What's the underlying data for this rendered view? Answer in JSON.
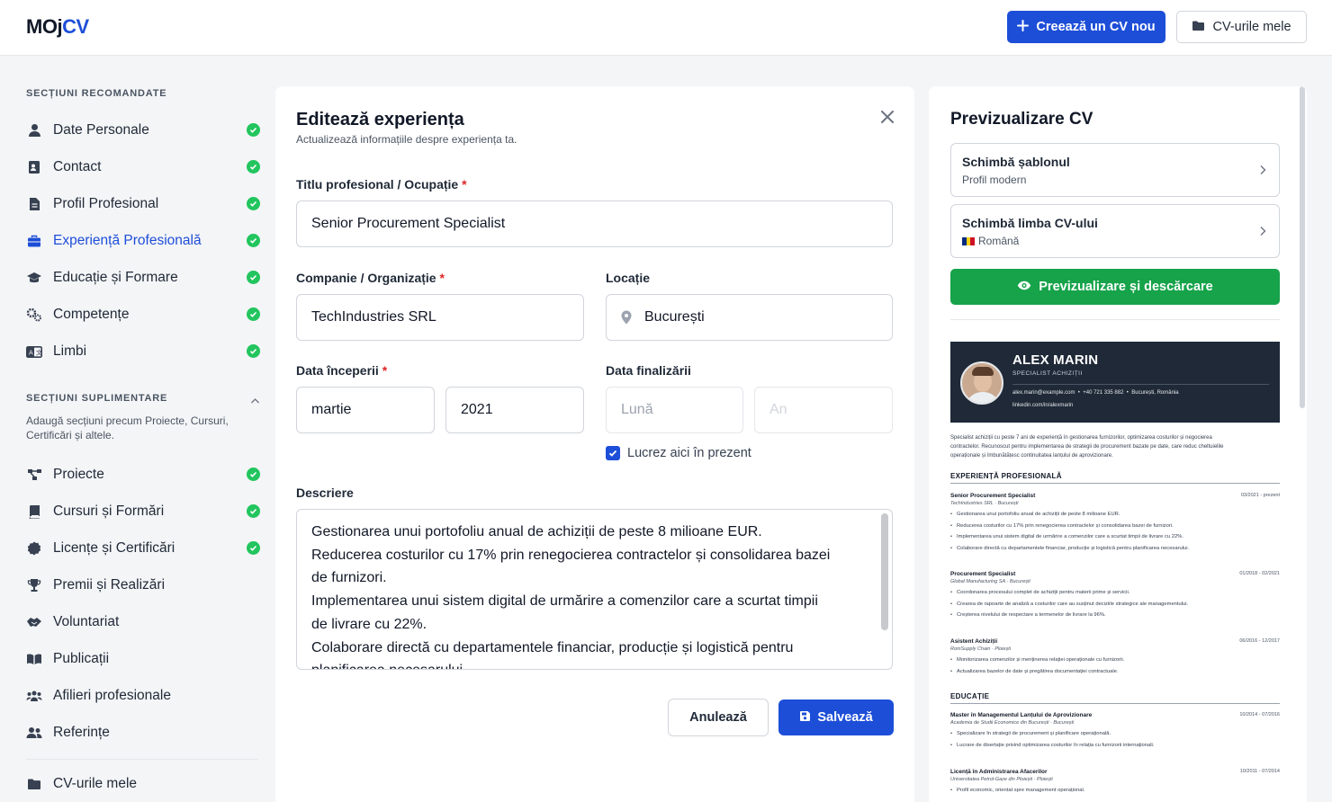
{
  "header": {
    "logo_main": "MOjCV",
    "logo_prefix": "MOj",
    "logo_accent": "CV",
    "new_cv_label": "Creează un CV nou",
    "my_cvs_label": "CV-urile mele"
  },
  "sidebar": {
    "recommended_title": "SECȚIUNI RECOMANDATE",
    "recommended": [
      {
        "label": "Date Personale",
        "icon": "user-icon",
        "done": true
      },
      {
        "label": "Contact",
        "icon": "contact-card-icon",
        "done": true
      },
      {
        "label": "Profil Profesional",
        "icon": "file-icon",
        "done": true
      },
      {
        "label": "Experiență Profesională",
        "icon": "briefcase-icon",
        "done": true,
        "active": true
      },
      {
        "label": "Educație și Formare",
        "icon": "graduation-cap-icon",
        "done": true
      },
      {
        "label": "Competențe",
        "icon": "gears-icon",
        "done": true
      },
      {
        "label": "Limbi",
        "icon": "language-icon",
        "done": true
      }
    ],
    "supplementary_title": "SECȚIUNI SUPLIMENTARE",
    "supplementary_desc": "Adaugă secțiuni precum Proiecte, Cursuri, Certificări și altele.",
    "supplementary": [
      {
        "label": "Proiecte",
        "icon": "project-diagram-icon",
        "done": true
      },
      {
        "label": "Cursuri și Formări",
        "icon": "book-icon",
        "done": true
      },
      {
        "label": "Licențe și Certificări",
        "icon": "certificate-icon",
        "done": true
      },
      {
        "label": "Premii și Realizări",
        "icon": "trophy-icon",
        "done": false
      },
      {
        "label": "Voluntariat",
        "icon": "handshake-icon",
        "done": false
      },
      {
        "label": "Publicații",
        "icon": "open-book-icon",
        "done": false
      },
      {
        "label": "Afilieri profesionale",
        "icon": "users-icon",
        "done": false
      },
      {
        "label": "Referințe",
        "icon": "user-friends-icon",
        "done": false
      }
    ],
    "my_cvs_label": "CV-urile mele"
  },
  "editor": {
    "title": "Editează experiența",
    "subtitle": "Actualizează informațiile despre experiența ta.",
    "job_title_label": "Titlu profesional / Ocupație",
    "job_title_value": "Senior Procurement Specialist",
    "company_label": "Companie / Organizație",
    "company_value": "TechIndustries SRL",
    "location_label": "Locație",
    "location_value": "București",
    "start_label": "Data începerii",
    "start_month": "martie",
    "start_year": "2021",
    "end_label": "Data finalizării",
    "end_month_placeholder": "Lună",
    "end_year_placeholder": "An",
    "current_label": "Lucrez aici în prezent",
    "current_checked": true,
    "description_label": "Descriere",
    "description_lines": [
      "Gestionarea unui portofoliu anual de achiziții de peste 8 milioane EUR.",
      "Reducerea costurilor cu 17% prin renegocierea contractelor și consolidarea bazei",
      "de furnizori.",
      "Implementarea unui sistem digital de urmărire a comenzilor care a scurtat timpii",
      "de livrare cu 22%.",
      "Colaborare directă cu departamentele financiar, producție și logistică pentru",
      "planificarea necesarului."
    ],
    "cancel_label": "Anulează",
    "save_label": "Salvează",
    "required_mark": "*"
  },
  "preview": {
    "title": "Previzualizare CV",
    "template_title": "Schimbă șablonul",
    "template_value": "Profil modern",
    "language_title": "Schimbă limba CV-ului",
    "language_value": "Română",
    "download_label": "Previzualizare și descărcare",
    "cv": {
      "name": "ALEX MARIN",
      "role": "SPECIALIST ACHIZIȚII",
      "email": "alex.marin@example.com",
      "phone": "+40 721 335 882",
      "location": "București, România",
      "linkedin": "linkedin.com/in/alexmarin",
      "summary_1": "Specialist achiziții cu peste 7 ani de experiență în gestionarea furnizorilor, optimizarea costurilor și negocierea",
      "summary_2": "contractelor. Recunoscut pentru implementarea de strategii de procurement bazate pe date, care reduc cheltuielile",
      "summary_3": "operaționale și îmbunătățesc continuitatea lanțului de aprovizionare.",
      "exp_heading": "EXPERIENȚĂ PROFESIONALĂ",
      "jobs": [
        {
          "title": "Senior Procurement Specialist",
          "company": "TechIndustries SRL · București",
          "dates": "03/2021 - prezent",
          "bullets": [
            "Gestionarea unui portofoliu anual de achiziții de peste 8 milioane EUR.",
            "Reducerea costurilor cu 17% prin renegocierea contractelor și consolidarea bazei de furnizori.",
            "Implementarea unui sistem digital de urmărire a comenzilor care a scurtat timpii de livrare cu 22%.",
            "Colaborare directă cu departamentele financiar, producție și logistică pentru planificarea necesarului."
          ]
        },
        {
          "title": "Procurement Specialist",
          "company": "Global Manufacturing SA · București",
          "dates": "01/2018 - 02/2021",
          "bullets": [
            "Coordonarea procesului complet de achiziții pentru materii prime și servicii.",
            "Crearea de rapoarte de analiză a costurilor care au susținut deciziile strategice ale managementului.",
            "Creșterea nivelului de respectare a termenelor de livrare la 96%."
          ]
        },
        {
          "title": "Asistent Achiziții",
          "company": "RomSupply Chain · Ploiești",
          "dates": "06/2016 - 12/2017",
          "bullets": [
            "Monitorizarea comenzilor și menținerea relației operaționale cu furnizorii.",
            "Actualizarea bazelor de date și pregătirea documentației contractuale."
          ]
        }
      ],
      "edu_heading": "EDUCAȚIE",
      "education": [
        {
          "title": "Master în Managementul Lanțului de Aprovizionare",
          "company": "Academia de Studii Economice din București · București",
          "dates": "10/2014 - 07/2016",
          "bullets": [
            "Specializare în strategii de procurement și planificare operațională.",
            "Lucrare de disertație privind optimizarea costurilor în relația cu furnizorii internaționali."
          ]
        },
        {
          "title": "Licență în Administrarea Afacerilor",
          "company": "Universitatea Petrol-Gaze din Ploiești · Ploiești",
          "dates": "10/2011 - 07/2014",
          "bullets": [
            "Profil economic, orientat spre management operațional."
          ]
        }
      ]
    }
  },
  "colors": {
    "accent": "#1d4ed8",
    "success": "#16a34a",
    "check": "#22c55e",
    "cv_header": "#1f2937"
  }
}
